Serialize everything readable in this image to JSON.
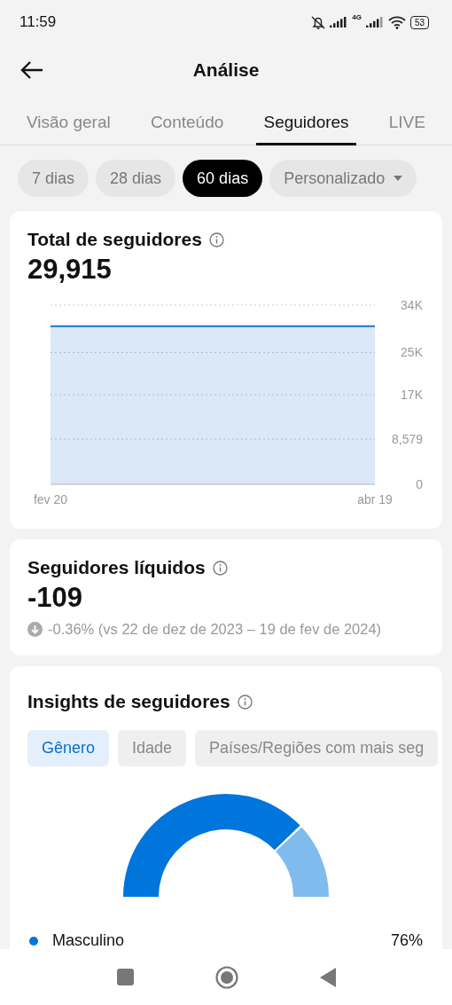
{
  "status_bar": {
    "time": "11:59",
    "network": "4G",
    "battery": "53"
  },
  "header": {
    "title": "Análise"
  },
  "tabs": [
    {
      "label": "Visão geral",
      "selected": false
    },
    {
      "label": "Conteúdo",
      "selected": false
    },
    {
      "label": "Seguidores",
      "selected": true
    },
    {
      "label": "LIVE",
      "selected": false
    }
  ],
  "periods": [
    {
      "label": "7 dias",
      "selected": false
    },
    {
      "label": "28 dias",
      "selected": false
    },
    {
      "label": "60 dias",
      "selected": true
    },
    {
      "label": "Personalizado",
      "selected": false,
      "kind": "dropdown"
    }
  ],
  "total_followers": {
    "title": "Total de seguidores",
    "value": "29,915",
    "chart_data": {
      "type": "area",
      "grid": true,
      "x": [
        "fev 20",
        "abr 19"
      ],
      "ylim": [
        0,
        34000
      ],
      "yticks": [
        {
          "value": 0,
          "label": "0"
        },
        {
          "value": 8579,
          "label": "8,579"
        },
        {
          "value": 17000,
          "label": "17K"
        },
        {
          "value": 25000,
          "label": "25K"
        },
        {
          "value": 34000,
          "label": "34K"
        }
      ],
      "series": [
        {
          "color": "#1a73d6",
          "values": [
            30000,
            30000
          ]
        }
      ]
    }
  },
  "net_followers": {
    "title": "Seguidores líquidos",
    "value": "-109",
    "change": "-0.36% (vs 22 de dez de 2023 – 19 de fev de 2024)"
  },
  "insights": {
    "title": "Insights de seguidores",
    "tabs": [
      {
        "label": "Gênero",
        "selected": true
      },
      {
        "label": "Idade",
        "selected": false
      },
      {
        "label": "Países/Regiões com mais seg",
        "selected": false
      }
    ],
    "legend": [
      {
        "label": "Masculino",
        "value": "76%",
        "color": "#0075db"
      }
    ]
  }
}
